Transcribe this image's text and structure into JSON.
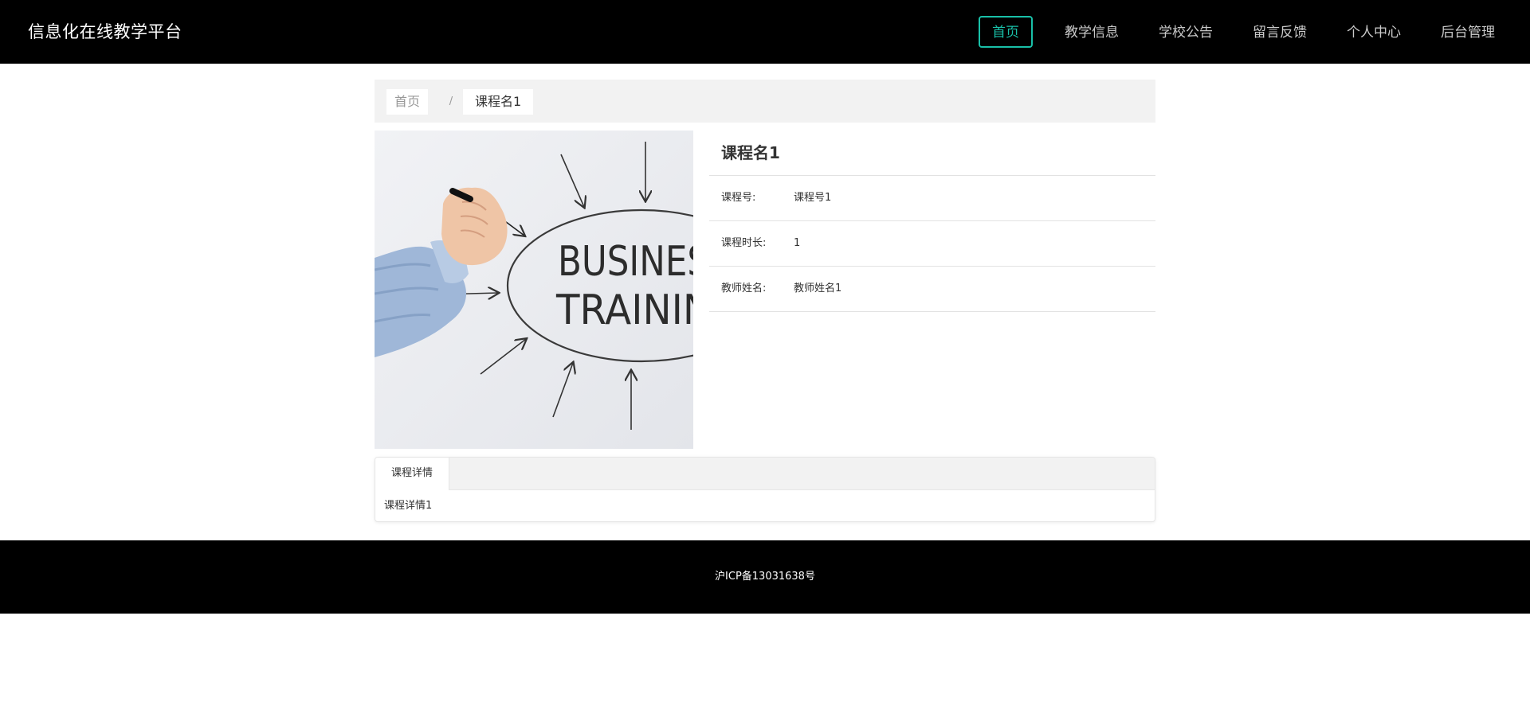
{
  "header": {
    "brand": "信息化在线教学平台",
    "nav": [
      {
        "label": "首页",
        "active": true
      },
      {
        "label": "教学信息"
      },
      {
        "label": "学校公告"
      },
      {
        "label": "留言反馈"
      },
      {
        "label": "个人中心"
      },
      {
        "label": "后台管理"
      }
    ]
  },
  "breadcrumb": {
    "home": "首页",
    "separator": "/",
    "current": "课程名1"
  },
  "image": {
    "line1": "BUSINES",
    "line2": "TRAININ"
  },
  "course": {
    "title": "课程名1",
    "rows": [
      {
        "label": "课程号:",
        "value": "课程号1"
      },
      {
        "label": "课程时长:",
        "value": "1"
      },
      {
        "label": "教师姓名:",
        "value": "教师姓名1"
      }
    ]
  },
  "tabs": {
    "active_label": "课程详情",
    "content": "课程详情1"
  },
  "footer": {
    "icp": "沪ICP备13031638号"
  },
  "colors": {
    "header_bg": "#000000",
    "accent": "#19c0a8"
  }
}
